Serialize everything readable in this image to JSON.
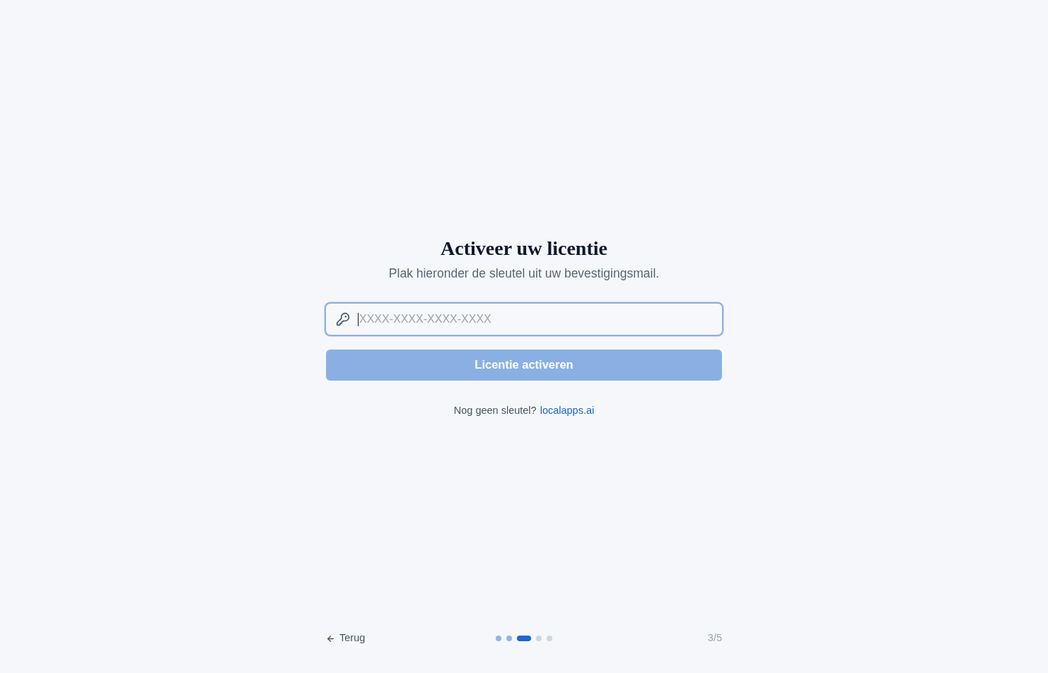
{
  "title": "Activeer uw licentie",
  "subtitle": "Plak hieronder de sleutel uit uw bevestigingsmail.",
  "license_field": {
    "placeholder": "XXXX-XXXX-XXXX-XXXX",
    "focused": true
  },
  "activate_button": {
    "label": "Licentie activeren",
    "disabled": true
  },
  "help": {
    "text": "Nog geen sleutel?",
    "link": "localapps.ai"
  },
  "footer": {
    "back_button": {
      "label": "Terug"
    },
    "steps": [
      {
        "kind": "done"
      },
      {
        "kind": "done"
      },
      {
        "kind": "current"
      },
      {
        "kind": "upcoming"
      },
      {
        "kind": "upcoming"
      }
    ],
    "step_counter": "3/5"
  }
}
